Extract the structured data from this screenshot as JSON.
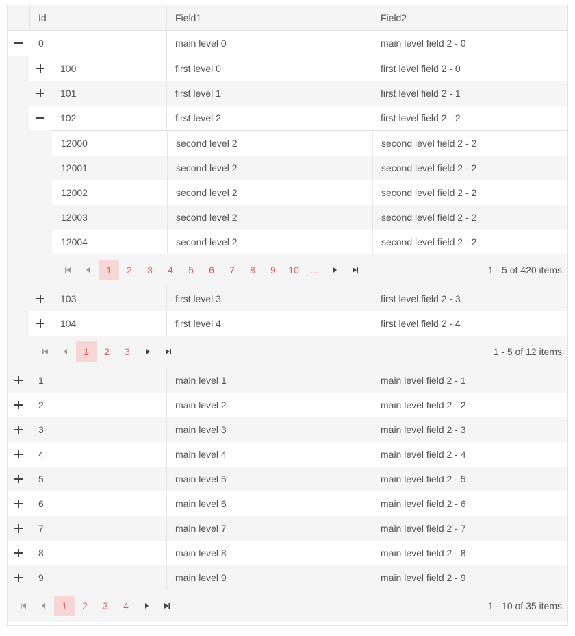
{
  "columns": {
    "id": "Id",
    "field1": "Field1",
    "field2": "Field2"
  },
  "colors": {
    "accent": "#e15a5a",
    "selected_page_bg": "#f7d6d6",
    "alt_row": "#f5f5f5",
    "border": "#e6e6e6"
  },
  "main_rows": [
    {
      "id": "0",
      "field1": "main level 0",
      "field2": "main level field 2 - 0",
      "expanded": true
    },
    {
      "id": "1",
      "field1": "main level 1",
      "field2": "main level field 2 - 1",
      "expanded": false
    },
    {
      "id": "2",
      "field1": "main level 2",
      "field2": "main level field 2 - 2",
      "expanded": false
    },
    {
      "id": "3",
      "field1": "main level 3",
      "field2": "main level field 2 - 3",
      "expanded": false
    },
    {
      "id": "4",
      "field1": "main level 4",
      "field2": "main level field 2 - 4",
      "expanded": false
    },
    {
      "id": "5",
      "field1": "main level 5",
      "field2": "main level field 2 - 5",
      "expanded": false
    },
    {
      "id": "6",
      "field1": "main level 6",
      "field2": "main level field 2 - 6",
      "expanded": false
    },
    {
      "id": "7",
      "field1": "main level 7",
      "field2": "main level field 2 - 7",
      "expanded": false
    },
    {
      "id": "8",
      "field1": "main level 8",
      "field2": "main level field 2 - 8",
      "expanded": false
    },
    {
      "id": "9",
      "field1": "main level 9",
      "field2": "main level field 2 - 9",
      "expanded": false
    }
  ],
  "first_level_rows": [
    {
      "id": "100",
      "field1": "first level 0",
      "field2": "first level field 2 - 0",
      "expanded": false
    },
    {
      "id": "101",
      "field1": "first level 1",
      "field2": "first level field 2 - 1",
      "expanded": false
    },
    {
      "id": "102",
      "field1": "first level 2",
      "field2": "first level field 2 - 2",
      "expanded": true
    },
    {
      "id": "103",
      "field1": "first level 3",
      "field2": "first level field 2 - 3",
      "expanded": false
    },
    {
      "id": "104",
      "field1": "first level 4",
      "field2": "first level field 2 - 4",
      "expanded": false
    }
  ],
  "second_level_rows": [
    {
      "id": "12000",
      "field1": "second level 2",
      "field2": "second level field 2 - 2"
    },
    {
      "id": "12001",
      "field1": "second level 2",
      "field2": "second level field 2 - 2"
    },
    {
      "id": "12002",
      "field1": "second level 2",
      "field2": "second level field 2 - 2"
    },
    {
      "id": "12003",
      "field1": "second level 2",
      "field2": "second level field 2 - 2"
    },
    {
      "id": "12004",
      "field1": "second level 2",
      "field2": "second level field 2 - 2"
    }
  ],
  "pagers": {
    "second_level": {
      "pages": [
        "1",
        "2",
        "3",
        "4",
        "5",
        "6",
        "7",
        "8",
        "9",
        "10",
        "..."
      ],
      "current": "1",
      "info": "1 - 5 of 420 items"
    },
    "first_level": {
      "pages": [
        "1",
        "2",
        "3"
      ],
      "current": "1",
      "info": "1 - 5 of 12 items"
    },
    "main": {
      "pages": [
        "1",
        "2",
        "3",
        "4"
      ],
      "current": "1",
      "info": "1 - 10 of 35 items"
    }
  },
  "icons": {
    "expand": "plus-icon",
    "collapse": "minus-icon",
    "first": "first-page-icon",
    "prev": "prev-page-icon",
    "next": "next-page-icon",
    "last": "last-page-icon"
  }
}
